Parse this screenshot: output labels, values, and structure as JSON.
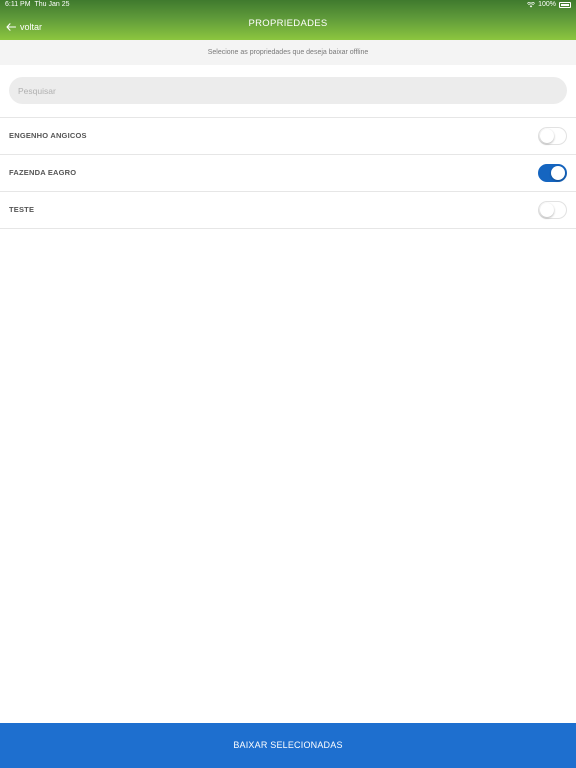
{
  "status_bar": {
    "time": "6:11 PM",
    "date": "Thu Jan 25",
    "battery": "100%"
  },
  "header": {
    "back_label": "voltar",
    "title": "PROPRIEDADES",
    "subtitle": "Selecione as propriedades que deseja baixar offline"
  },
  "search": {
    "placeholder": "Pesquisar",
    "value": ""
  },
  "properties": [
    {
      "name": "ENGENHO ANGICOS",
      "selected": false
    },
    {
      "name": "FAZENDA EAGRO",
      "selected": true
    },
    {
      "name": "TESTE",
      "selected": false
    }
  ],
  "footer": {
    "download_label": "BAIXAR SELECIONADAS"
  },
  "colors": {
    "header_top": "#3f7a2e",
    "header_bottom": "#8cc63f",
    "toggle_on": "#1565c0",
    "footer_button": "#1e6fcf"
  }
}
